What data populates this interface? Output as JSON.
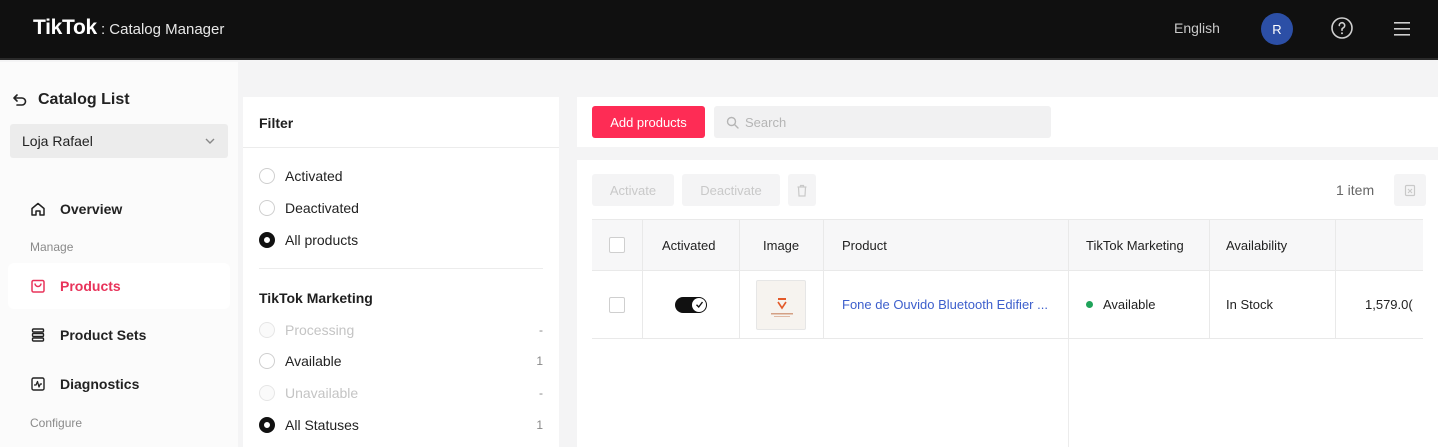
{
  "header": {
    "brand": "TikTok",
    "product": ": Catalog Manager",
    "language": "English",
    "avatar_initial": "R"
  },
  "sidebar": {
    "back_label": "Catalog List",
    "store_name": "Loja Rafael",
    "items": [
      {
        "label": "Overview",
        "icon": "home-icon"
      },
      {
        "label": "Products",
        "icon": "bag-icon",
        "active": true
      },
      {
        "label": "Product Sets",
        "icon": "layers-icon"
      },
      {
        "label": "Diagnostics",
        "icon": "pulse-icon"
      }
    ],
    "section_manage": "Manage",
    "section_configure": "Configure"
  },
  "filter": {
    "title": "Filter",
    "activation": [
      {
        "label": "Activated",
        "selected": false
      },
      {
        "label": "Deactivated",
        "selected": false
      },
      {
        "label": "All products",
        "selected": true
      }
    ],
    "marketing_title": "TikTok Marketing",
    "marketing": [
      {
        "label": "Processing",
        "count": "-",
        "disabled": true
      },
      {
        "label": "Available",
        "count": "1",
        "disabled": false
      },
      {
        "label": "Unavailable",
        "count": "-",
        "disabled": true
      },
      {
        "label": "All Statuses",
        "count": "1",
        "selected": true
      }
    ]
  },
  "toolbar": {
    "add_label": "Add products",
    "search_placeholder": "Search",
    "activate_label": "Activate",
    "deactivate_label": "Deactivate",
    "item_count": "1 item"
  },
  "table": {
    "headers": [
      "Activated",
      "Image",
      "Product",
      "TikTok Marketing",
      "Availability"
    ],
    "rows": [
      {
        "activated": true,
        "product": "Fone de Ouvido Bluetooth Edifier ...",
        "marketing": "Available",
        "availability": "In Stock",
        "price": "1,579.0("
      }
    ]
  },
  "colors": {
    "accent": "#fe2c55",
    "active_nav": "#e8335a",
    "link": "#3d5fcc",
    "status_ok": "#1fa35a"
  }
}
